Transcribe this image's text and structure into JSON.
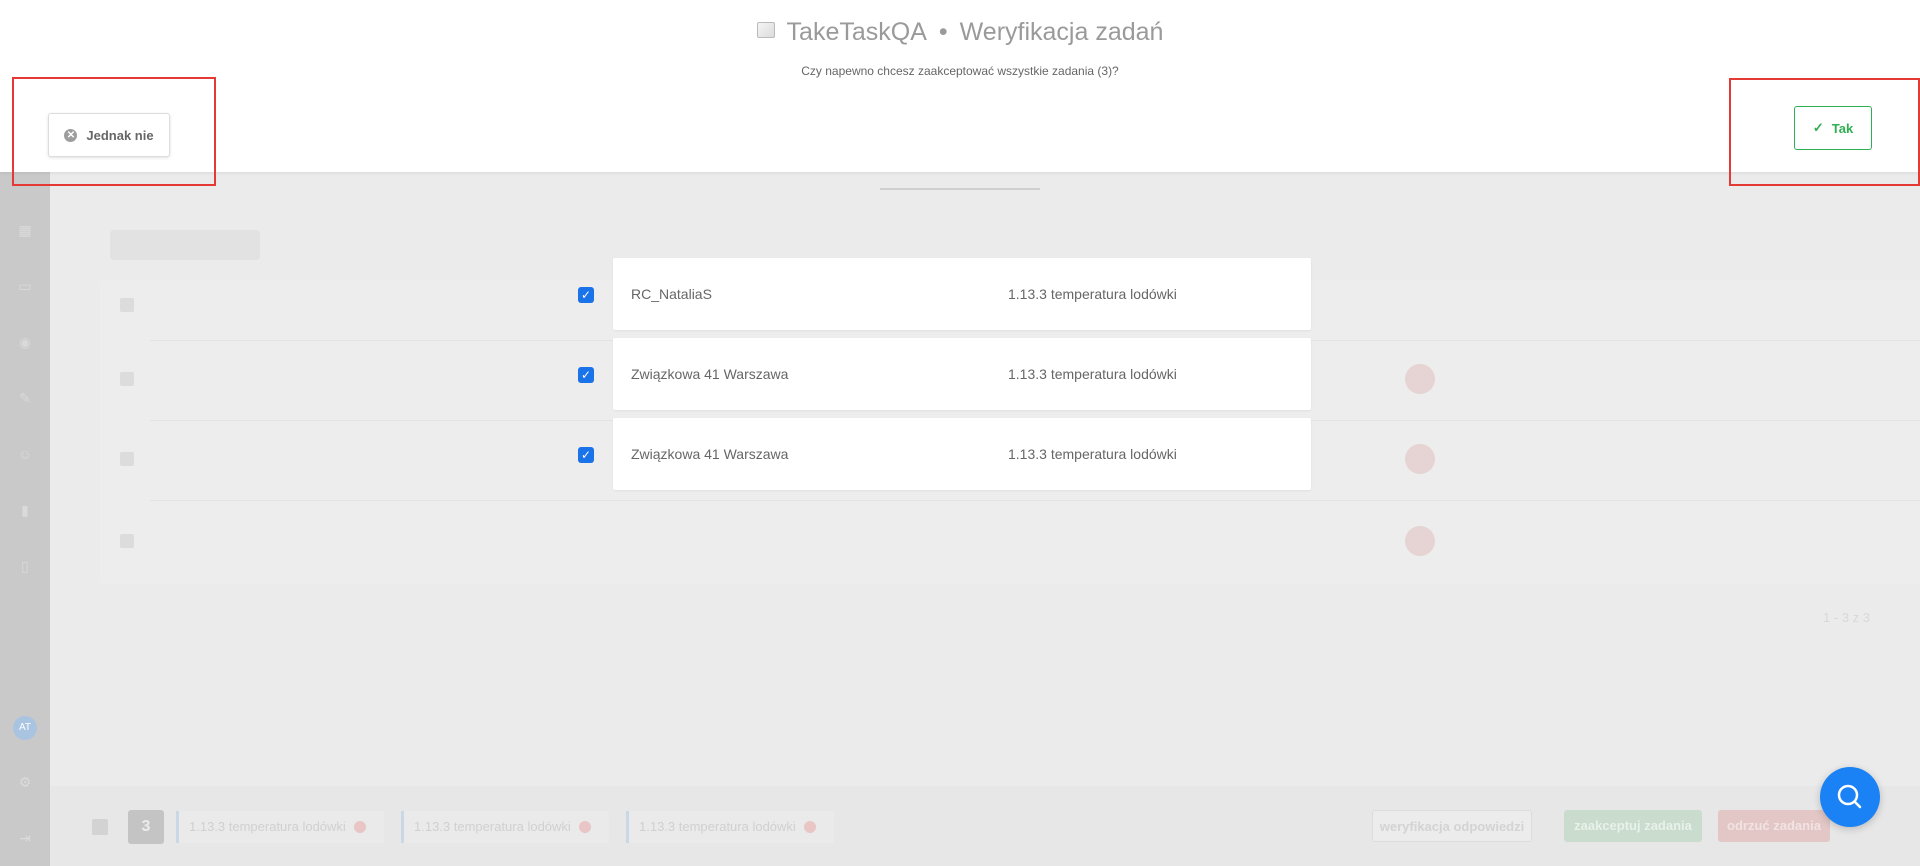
{
  "modal": {
    "app_name": "TakeTaskQA",
    "separator": "•",
    "page_title": "Weryfikacja zadań",
    "question": "Czy napewno chcesz zaakceptować wszystkie zadania (3)?",
    "cancel_label": "Jednak nie",
    "confirm_label": "Tak",
    "tasks": [
      {
        "location": "RC_NataliaS",
        "task": "1.13.3 temperatura lodówki",
        "checked": true
      },
      {
        "location": "Związkowa 41 Warszawa",
        "task": "1.13.3 temperatura lodówki",
        "checked": true
      },
      {
        "location": "Związkowa 41 Warszawa",
        "task": "1.13.3 temperatura lodówki",
        "checked": true
      }
    ]
  },
  "background": {
    "nav_avatar": "AT",
    "pagination": "1 - 3 z 3",
    "selection_bar": {
      "count": "3",
      "tags": [
        "1.13.3 temperatura lodówki",
        "1.13.3 temperatura lodówki",
        "1.13.3 temperatura lodówki"
      ],
      "verify_label": "weryfikacja odpowiedzi",
      "accept_label": "zaakceptuj zadania",
      "reject_label": "odrzuć zadania"
    }
  },
  "colors": {
    "accent": "#1a82f4",
    "confirm": "#2fae52",
    "checkbox": "#1a73e8",
    "highlight": "#e53935"
  },
  "icons": {
    "cancel": "circle-x-icon",
    "confirm": "check-icon",
    "fab": "search-icon"
  }
}
